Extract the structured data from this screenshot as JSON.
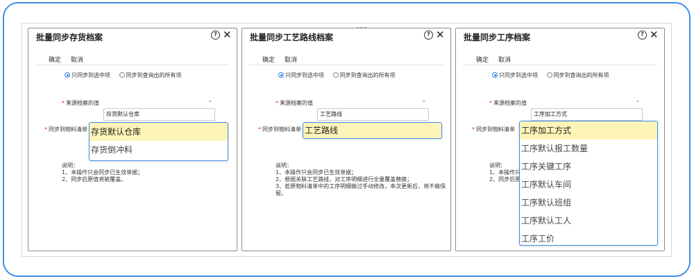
{
  "dialog1": {
    "title": "批量同步存货档案",
    "toolbar": {
      "confirm": "确定",
      "cancel": "取消"
    },
    "radio": {
      "selected": "只同步到选中项",
      "all": "同步到查询出的所有项"
    },
    "source_label": "来源档案的值",
    "target_label": "同步到物料清单",
    "selected_value": "存货默认仓库",
    "options": [
      "存货默认仓库",
      "存货倒冲料"
    ],
    "notes": [
      "说明：",
      "1、本操作只会同步已生效单据；",
      "2、同步后原值将被覆盖。"
    ]
  },
  "dialog2": {
    "title": "批量同步工艺路线档案",
    "toolbar": {
      "confirm": "确定",
      "cancel": "取消"
    },
    "radio": {
      "selected": "只同步到选中项",
      "all": "同步到查询出的所有项"
    },
    "source_label": "来源档案的值",
    "target_label": "同步到物料清单",
    "selected_value": "工艺路线",
    "options": [
      "工艺路线"
    ],
    "notes": [
      "说明：",
      "1、本操作只会同步已生效单据；",
      "2、根据关联工艺路线，对工序明细进行全量覆盖替换；",
      "3、若原物料清单中的工序明细做过手动修改，本次更新后，将不做保",
      "留。"
    ]
  },
  "dialog3": {
    "title": "批量同步工序档案",
    "toolbar": {
      "confirm": "确定",
      "cancel": "取消"
    },
    "radio": {
      "selected": "只同步到选中项",
      "all": "同步到查询出的所有项"
    },
    "source_label": "来源档案的值",
    "target_label": "同步到物料清单",
    "selected_value": "工序加工方式",
    "options": [
      "工序加工方式",
      "工序默认报工数量",
      "工序关键工序",
      "工序默认车间",
      "工序默认班组",
      "工序默认工人",
      "工序工价"
    ],
    "notes": [
      "说明：",
      "1、本操作只",
      "2、同步后原"
    ]
  },
  "icons": {
    "help": "help-circle-icon",
    "close": "close-icon",
    "dropdown": "chevron-down-icon"
  },
  "colors": {
    "accent": "#2f7ee8",
    "required": "#e0282e",
    "highlight": "#fdf5b8",
    "frame": "#3d8ee8"
  }
}
